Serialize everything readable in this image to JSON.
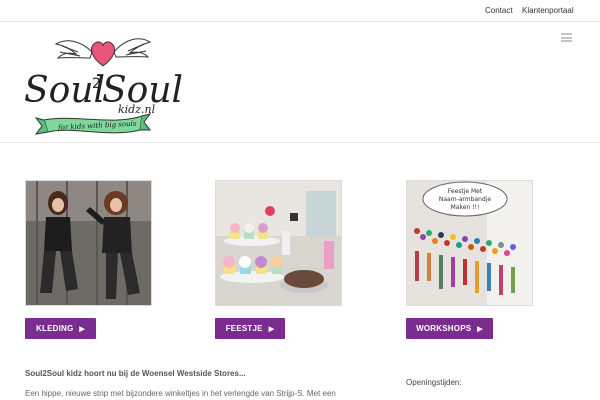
{
  "topbar": {
    "contact_label": "Contact",
    "portal_label": "Klantenportaal"
  },
  "logo": {
    "brand": "Soul2Soul",
    "domain": "kidz.nl",
    "tagline": "for kids with big souls"
  },
  "header": {
    "menu_icon": "hamburger-menu-icon"
  },
  "cards": [
    {
      "image": "girls-jumping-photo",
      "button_label": "KLEDING",
      "icon": "play-arrow-icon"
    },
    {
      "image": "party-cupcakes-photo",
      "button_label": "FEESTJE",
      "icon": "play-arrow-icon"
    },
    {
      "image": "bead-bracelets-photo",
      "image_sign_text": "Feestje Met Naam-armbandje Maken !!!",
      "button_label": "WORKSHOPS",
      "icon": "play-arrow-icon"
    }
  ],
  "content": {
    "heading": "Soul2Soul kidz hoort nu bij de Woensel Westside Stores...",
    "paragraph": "Een hippe, nieuwe strip met bijzondere winkeltjes in het verlengde van Strijp-S.  Met een",
    "hours_label": "Openingstijden:"
  },
  "colors": {
    "button_bg": "#7b2c8f",
    "ribbon": "#7ed89b",
    "heart": "#e8557a"
  }
}
